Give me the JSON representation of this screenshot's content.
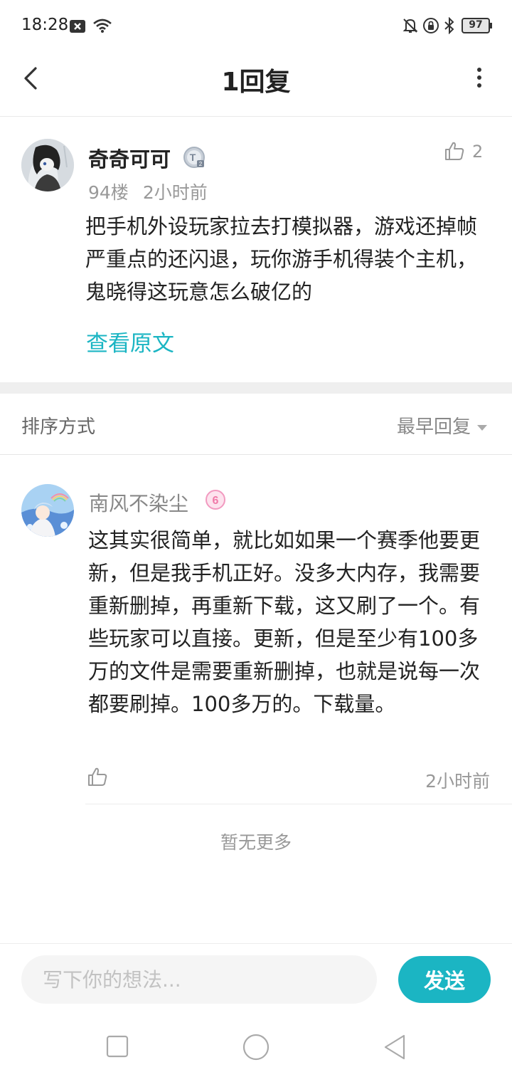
{
  "status_bar": {
    "time": "18:28",
    "battery": "97",
    "icons": [
      "close-box-icon",
      "wifi-icon",
      "bell-off-icon",
      "lock-rotation-icon",
      "bluetooth-icon",
      "battery-icon"
    ]
  },
  "header": {
    "title": "1回复"
  },
  "post": {
    "username": "奇奇可可",
    "level_badge": "T",
    "level_sub": "2",
    "like_count": "2",
    "floor": "94楼",
    "time": "2小时前",
    "content": "把手机外设玩家拉去打模拟器，游戏还掉帧严重点的还闪退，玩你游手机得装个主机，鬼晓得这玩意怎么破亿的",
    "view_original": "查看原文"
  },
  "sort": {
    "label": "排序方式",
    "value": "最早回复"
  },
  "reply": {
    "username": "南风不染尘",
    "level": "6",
    "content": "这其实很简单，就比如如果一个赛季他要更新，但是我手机正好。没多大内存，我需要重新删掉，再重新下载，这又刷了一个。有些玩家可以直接。更新，但是至少有100多万的文件是需要重新删掉，也就是说每一次都要刷掉。100多万的。下载量。",
    "time": "2小时前"
  },
  "footer_note": "暂无更多",
  "compose": {
    "placeholder": "写下你的想法...",
    "send_label": "发送"
  },
  "colors": {
    "accent": "#1bb5c3",
    "muted": "#999999",
    "divider_band": "#efefef",
    "level_badge_pink": "#f29ac0"
  }
}
